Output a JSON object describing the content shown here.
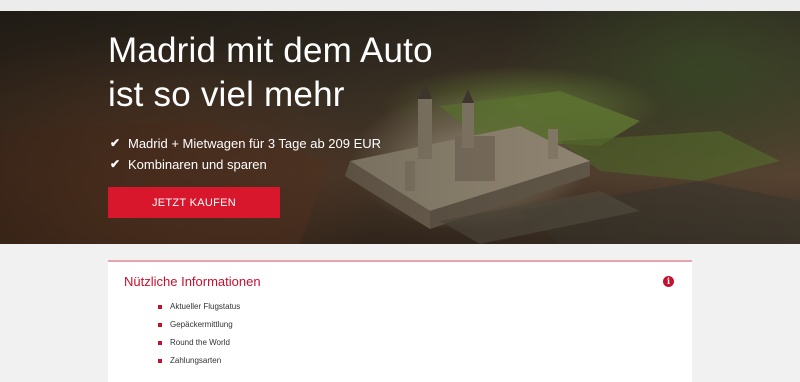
{
  "hero": {
    "title_line1": "Madrid mit dem Auto",
    "title_line2": "ist so viel mehr",
    "benefits": [
      "Madrid + Mietwagen für 3 Tage ab 209 EUR",
      "Kombinaren und sparen"
    ],
    "cta_label": "JETZT KAUFEN"
  },
  "info": {
    "title": "Nützliche Informationen",
    "links": [
      "Aktueller Flugstatus",
      "Gepäckermittlung",
      "Round the World",
      "Zahlungsarten"
    ]
  },
  "colors": {
    "accent": "#d8172c",
    "panel_border": "#e8a4ac"
  },
  "icons": {
    "benefit": "check-icon",
    "info": "info-icon",
    "link_bullet": "square-bullet-icon"
  }
}
